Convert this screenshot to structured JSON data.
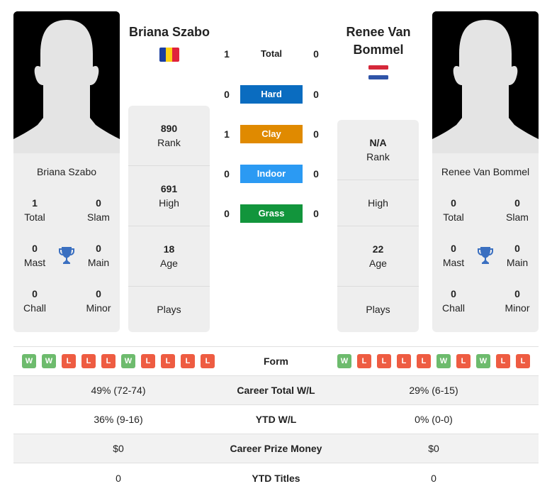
{
  "player1": {
    "name": "Briana Szabo",
    "country_flag": "romania-flag",
    "titles": {
      "total": {
        "value": "1",
        "label": "Total"
      },
      "slam": {
        "value": "0",
        "label": "Slam"
      },
      "mast": {
        "value": "0",
        "label": "Mast"
      },
      "main": {
        "value": "0",
        "label": "Main"
      },
      "chall": {
        "value": "0",
        "label": "Chall"
      },
      "minor": {
        "value": "0",
        "label": "Minor"
      }
    },
    "stats": {
      "rank": {
        "value": "890",
        "label": "Rank"
      },
      "high": {
        "value": "691",
        "label": "High"
      },
      "age": {
        "value": "18",
        "label": "Age"
      },
      "plays": {
        "value": "",
        "label": "Plays"
      }
    },
    "form": [
      "W",
      "W",
      "L",
      "L",
      "L",
      "W",
      "L",
      "L",
      "L",
      "L"
    ],
    "career_wl": "49% (72-74)",
    "ytd_wl": "36% (9-16)",
    "prize_money": "$0",
    "ytd_titles": "0"
  },
  "player2": {
    "name": "Renee Van Bommel",
    "country_flag": "netherlands-flag",
    "titles": {
      "total": {
        "value": "0",
        "label": "Total"
      },
      "slam": {
        "value": "0",
        "label": "Slam"
      },
      "mast": {
        "value": "0",
        "label": "Mast"
      },
      "main": {
        "value": "0",
        "label": "Main"
      },
      "chall": {
        "value": "0",
        "label": "Chall"
      },
      "minor": {
        "value": "0",
        "label": "Minor"
      }
    },
    "stats": {
      "rank": {
        "value": "N/A",
        "label": "Rank"
      },
      "high": {
        "value": "",
        "label": "High"
      },
      "age": {
        "value": "22",
        "label": "Age"
      },
      "plays": {
        "value": "",
        "label": "Plays"
      }
    },
    "form": [
      "W",
      "L",
      "L",
      "L",
      "L",
      "W",
      "L",
      "W",
      "L",
      "L"
    ],
    "career_wl": "29% (6-15)",
    "ytd_wl": "0% (0-0)",
    "prize_money": "$0",
    "ytd_titles": "0"
  },
  "h2h": [
    {
      "label": "Total",
      "p1": "1",
      "p2": "0",
      "color": ""
    },
    {
      "label": "Hard",
      "p1": "0",
      "p2": "0",
      "color": "#0a6cc0"
    },
    {
      "label": "Clay",
      "p1": "1",
      "p2": "0",
      "color": "#e08a00"
    },
    {
      "label": "Indoor",
      "p1": "0",
      "p2": "0",
      "color": "#2b9af3"
    },
    {
      "label": "Grass",
      "p1": "0",
      "p2": "0",
      "color": "#12953c"
    }
  ],
  "comparison_labels": {
    "form": "Form",
    "career_wl": "Career Total W/L",
    "ytd_wl": "YTD W/L",
    "prize_money": "Career Prize Money",
    "ytd_titles": "YTD Titles"
  }
}
